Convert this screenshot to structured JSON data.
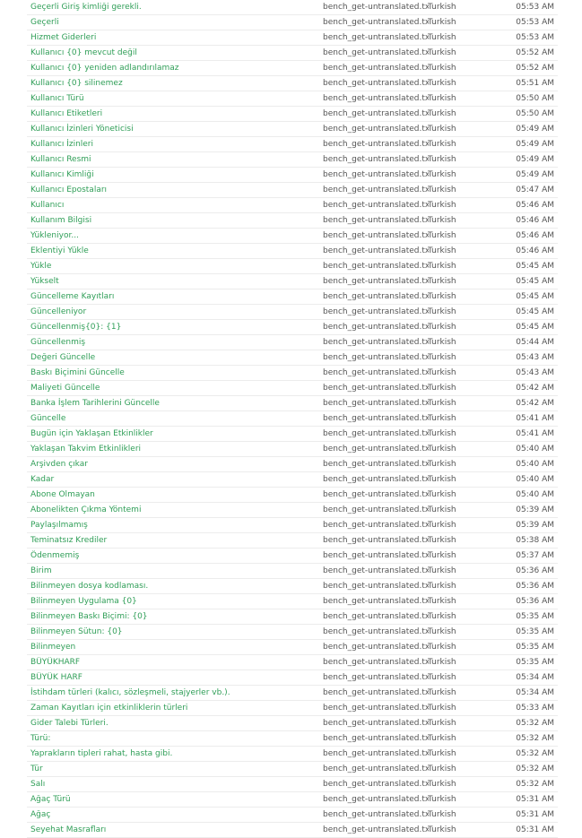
{
  "log": {
    "rows": [
      {
        "text": "Geçerli Giriş kimliği gerekli.",
        "file": "bench_get-untranslated.txt",
        "language": "Turkish",
        "time": "05:53 AM"
      },
      {
        "text": "Geçerli",
        "file": "bench_get-untranslated.txt",
        "language": "Turkish",
        "time": "05:53 AM"
      },
      {
        "text": "Hizmet Giderleri",
        "file": "bench_get-untranslated.txt",
        "language": "Turkish",
        "time": "05:53 AM"
      },
      {
        "text": "Kullanıcı {0} mevcut değil",
        "file": "bench_get-untranslated.txt",
        "language": "Turkish",
        "time": "05:52 AM"
      },
      {
        "text": "Kullanıcı {0} yeniden adlandırılamaz",
        "file": "bench_get-untranslated.txt",
        "language": "Turkish",
        "time": "05:52 AM"
      },
      {
        "text": "Kullanıcı {0} silinemez",
        "file": "bench_get-untranslated.txt",
        "language": "Turkish",
        "time": "05:51 AM"
      },
      {
        "text": "Kullanıcı Türü",
        "file": "bench_get-untranslated.txt",
        "language": "Turkish",
        "time": "05:50 AM"
      },
      {
        "text": "Kullanıcı Etiketleri",
        "file": "bench_get-untranslated.txt",
        "language": "Turkish",
        "time": "05:50 AM"
      },
      {
        "text": "Kullanıcı İzinleri Yöneticisi",
        "file": "bench_get-untranslated.txt",
        "language": "Turkish",
        "time": "05:49 AM"
      },
      {
        "text": "Kullanıcı İzinleri",
        "file": "bench_get-untranslated.txt",
        "language": "Turkish",
        "time": "05:49 AM"
      },
      {
        "text": "Kullanıcı Resmi",
        "file": "bench_get-untranslated.txt",
        "language": "Turkish",
        "time": "05:49 AM"
      },
      {
        "text": "Kullanıcı Kimliği",
        "file": "bench_get-untranslated.txt",
        "language": "Turkish",
        "time": "05:49 AM"
      },
      {
        "text": "Kullanıcı Epostaları",
        "file": "bench_get-untranslated.txt",
        "language": "Turkish",
        "time": "05:47 AM"
      },
      {
        "text": "Kullanıcı",
        "file": "bench_get-untranslated.txt",
        "language": "Turkish",
        "time": "05:46 AM"
      },
      {
        "text": "Kullanım Bilgisi",
        "file": "bench_get-untranslated.txt",
        "language": "Turkish",
        "time": "05:46 AM"
      },
      {
        "text": "Yükleniyor...",
        "file": "bench_get-untranslated.txt",
        "language": "Turkish",
        "time": "05:46 AM"
      },
      {
        "text": "Eklentiyi Yükle",
        "file": "bench_get-untranslated.txt",
        "language": "Turkish",
        "time": "05:46 AM"
      },
      {
        "text": "Yükle",
        "file": "bench_get-untranslated.txt",
        "language": "Turkish",
        "time": "05:45 AM"
      },
      {
        "text": "Yükselt",
        "file": "bench_get-untranslated.txt",
        "language": "Turkish",
        "time": "05:45 AM"
      },
      {
        "text": "Güncelleme Kayıtları",
        "file": "bench_get-untranslated.txt",
        "language": "Turkish",
        "time": "05:45 AM"
      },
      {
        "text": "Güncelleniyor",
        "file": "bench_get-untranslated.txt",
        "language": "Turkish",
        "time": "05:45 AM"
      },
      {
        "text": "Güncellenmiş{0}: {1}",
        "file": "bench_get-untranslated.txt",
        "language": "Turkish",
        "time": "05:45 AM"
      },
      {
        "text": "Güncellenmiş",
        "file": "bench_get-untranslated.txt",
        "language": "Turkish",
        "time": "05:44 AM"
      },
      {
        "text": "Değeri Güncelle",
        "file": "bench_get-untranslated.txt",
        "language": "Turkish",
        "time": "05:43 AM"
      },
      {
        "text": "Baskı Biçimini Güncelle",
        "file": "bench_get-untranslated.txt",
        "language": "Turkish",
        "time": "05:43 AM"
      },
      {
        "text": "Maliyeti Güncelle",
        "file": "bench_get-untranslated.txt",
        "language": "Turkish",
        "time": "05:42 AM"
      },
      {
        "text": "Banka İşlem Tarihlerini Güncelle",
        "file": "bench_get-untranslated.txt",
        "language": "Turkish",
        "time": "05:42 AM"
      },
      {
        "text": "Güncelle",
        "file": "bench_get-untranslated.txt",
        "language": "Turkish",
        "time": "05:41 AM"
      },
      {
        "text": "Bugün için Yaklaşan Etkinlikler",
        "file": "bench_get-untranslated.txt",
        "language": "Turkish",
        "time": "05:41 AM"
      },
      {
        "text": "Yaklaşan Takvim Etkinlikleri",
        "file": "bench_get-untranslated.txt",
        "language": "Turkish",
        "time": "05:40 AM"
      },
      {
        "text": "Arşivden çıkar",
        "file": "bench_get-untranslated.txt",
        "language": "Turkish",
        "time": "05:40 AM"
      },
      {
        "text": "Kadar",
        "file": "bench_get-untranslated.txt",
        "language": "Turkish",
        "time": "05:40 AM"
      },
      {
        "text": "Abone Olmayan",
        "file": "bench_get-untranslated.txt",
        "language": "Turkish",
        "time": "05:40 AM"
      },
      {
        "text": "Abonelikten Çıkma Yöntemi",
        "file": "bench_get-untranslated.txt",
        "language": "Turkish",
        "time": "05:39 AM"
      },
      {
        "text": "Paylaşılmamış",
        "file": "bench_get-untranslated.txt",
        "language": "Turkish",
        "time": "05:39 AM"
      },
      {
        "text": "Teminatsız Krediler",
        "file": "bench_get-untranslated.txt",
        "language": "Turkish",
        "time": "05:38 AM"
      },
      {
        "text": "Ödenmemiş",
        "file": "bench_get-untranslated.txt",
        "language": "Turkish",
        "time": "05:37 AM"
      },
      {
        "text": "Birim",
        "file": "bench_get-untranslated.txt",
        "language": "Turkish",
        "time": "05:36 AM"
      },
      {
        "text": "Bilinmeyen dosya kodlaması.",
        "file": "bench_get-untranslated.txt",
        "language": "Turkish",
        "time": "05:36 AM"
      },
      {
        "text": "Bilinmeyen Uygulama {0}",
        "file": "bench_get-untranslated.txt",
        "language": "Turkish",
        "time": "05:36 AM"
      },
      {
        "text": "Bilinmeyen Baskı Biçimi: {0}",
        "file": "bench_get-untranslated.txt",
        "language": "Turkish",
        "time": "05:35 AM"
      },
      {
        "text": "Bilinmeyen Sütun: {0}",
        "file": "bench_get-untranslated.txt",
        "language": "Turkish",
        "time": "05:35 AM"
      },
      {
        "text": "Bilinmeyen",
        "file": "bench_get-untranslated.txt",
        "language": "Turkish",
        "time": "05:35 AM"
      },
      {
        "text": "BÜYÜKHARF",
        "file": "bench_get-untranslated.txt",
        "language": "Turkish",
        "time": "05:35 AM"
      },
      {
        "text": "BÜYÜK HARF",
        "file": "bench_get-untranslated.txt",
        "language": "Turkish",
        "time": "05:34 AM"
      },
      {
        "text": "İstihdam türleri (kalıcı, sözleşmeli, stajyerler vb.).",
        "file": "bench_get-untranslated.txt",
        "language": "Turkish",
        "time": "05:34 AM"
      },
      {
        "text": "Zaman Kayıtları için etkinliklerin türleri",
        "file": "bench_get-untranslated.txt",
        "language": "Turkish",
        "time": "05:33 AM"
      },
      {
        "text": "Gider Talebi Türleri.",
        "file": "bench_get-untranslated.txt",
        "language": "Turkish",
        "time": "05:32 AM"
      },
      {
        "text": "Türü:",
        "file": "bench_get-untranslated.txt",
        "language": "Turkish",
        "time": "05:32 AM"
      },
      {
        "text": "Yaprakların tipleri rahat, hasta gibi.",
        "file": "bench_get-untranslated.txt",
        "language": "Turkish",
        "time": "05:32 AM"
      },
      {
        "text": "Tür",
        "file": "bench_get-untranslated.txt",
        "language": "Turkish",
        "time": "05:32 AM"
      },
      {
        "text": "Salı",
        "file": "bench_get-untranslated.txt",
        "language": "Turkish",
        "time": "05:32 AM"
      },
      {
        "text": "Ağaç Türü",
        "file": "bench_get-untranslated.txt",
        "language": "Turkish",
        "time": "05:31 AM"
      },
      {
        "text": "Ağaç",
        "file": "bench_get-untranslated.txt",
        "language": "Turkish",
        "time": "05:31 AM"
      },
      {
        "text": "Seyehat Masrafları",
        "file": "bench_get-untranslated.txt",
        "language": "Turkish",
        "time": "05:31 AM"
      }
    ]
  }
}
